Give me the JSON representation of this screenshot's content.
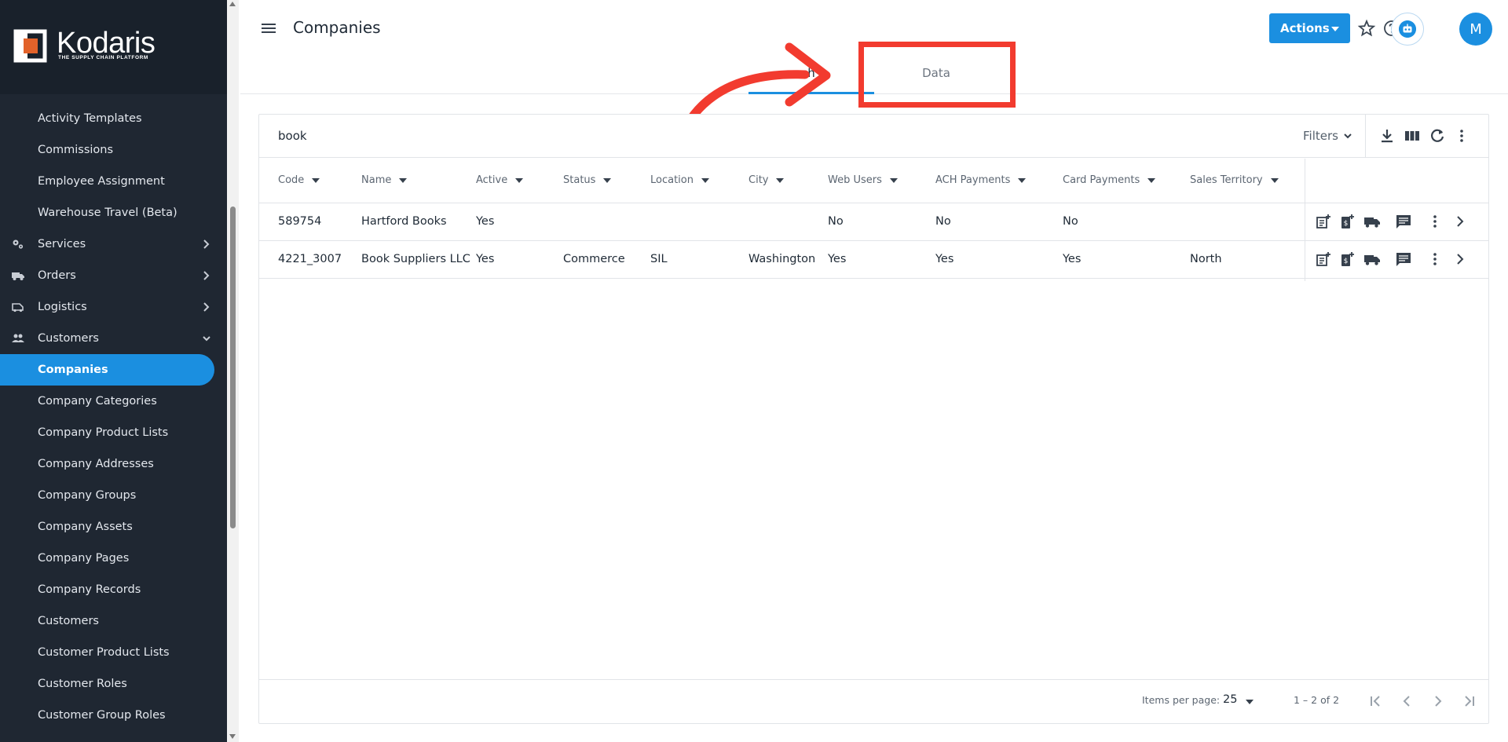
{
  "brand": {
    "name": "Kodaris",
    "tagline": "THE SUPPLY CHAIN PLATFORM",
    "accent": "#1b8fe0",
    "sidebar_bg": "#1f2732",
    "highlight": "#f23b2f"
  },
  "sidebar": {
    "items": [
      {
        "label": "Activity Templates",
        "type": "link"
      },
      {
        "label": "Commissions",
        "type": "link"
      },
      {
        "label": "Employee Assignment",
        "type": "link"
      },
      {
        "label": "Warehouse Travel (Beta)",
        "type": "link"
      },
      {
        "label": "Services",
        "type": "group",
        "icon": "gears-icon",
        "expanded": false
      },
      {
        "label": "Orders",
        "type": "group",
        "icon": "truck-icon",
        "expanded": false
      },
      {
        "label": "Logistics",
        "type": "group",
        "icon": "delivery-van-icon",
        "expanded": false
      },
      {
        "label": "Customers",
        "type": "group",
        "icon": "people-icon",
        "expanded": true
      },
      {
        "label": "Companies",
        "type": "link",
        "active": true
      },
      {
        "label": "Company Categories",
        "type": "link"
      },
      {
        "label": "Company Product Lists",
        "type": "link"
      },
      {
        "label": "Company Addresses",
        "type": "link"
      },
      {
        "label": "Company Groups",
        "type": "link"
      },
      {
        "label": "Company Assets",
        "type": "link"
      },
      {
        "label": "Company Pages",
        "type": "link"
      },
      {
        "label": "Company Records",
        "type": "link"
      },
      {
        "label": "Customers",
        "type": "link"
      },
      {
        "label": "Customer Product Lists",
        "type": "link"
      },
      {
        "label": "Customer Roles",
        "type": "link"
      },
      {
        "label": "Customer Group Roles",
        "type": "link"
      }
    ]
  },
  "header": {
    "title": "Companies",
    "actions_label": "Actions",
    "avatar_initial": "M",
    "tabs": [
      {
        "label": "h",
        "active": true
      },
      {
        "label": "Data",
        "active": false
      }
    ]
  },
  "search": {
    "value": "book",
    "filters_label": "Filters"
  },
  "table": {
    "columns": [
      "Code",
      "Name",
      "Active",
      "Status",
      "Location",
      "City",
      "Web Users",
      "ACH Payments",
      "Card Payments",
      "Sales Territory"
    ],
    "rows": [
      [
        "589754",
        "Hartford Books",
        "Yes",
        "",
        "",
        "",
        "No",
        "No",
        "No",
        ""
      ],
      [
        "4221_3007",
        "Book Suppliers LLC",
        "Yes",
        "Commerce",
        "SIL",
        "Washington",
        "Yes",
        "Yes",
        "Yes",
        "North"
      ]
    ],
    "row_action_icons": [
      "add-note-icon",
      "add-payment-icon",
      "shipping-icon",
      "comment-icon",
      "more-vert-icon",
      "chevron-right-icon"
    ]
  },
  "footer": {
    "items_per_page_label": "Items per page:",
    "items_per_page": "25",
    "range": "1 – 2 of 2"
  }
}
